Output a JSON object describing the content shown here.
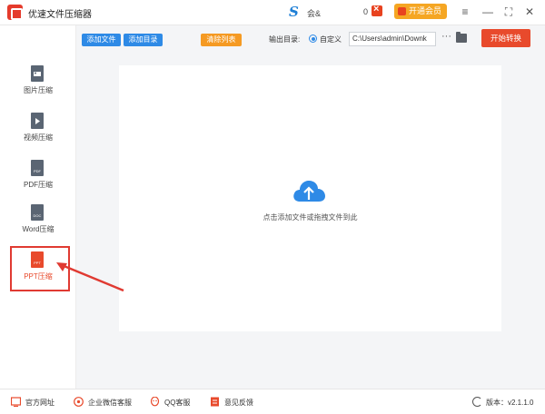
{
  "window": {
    "title": "优速文件压缩器",
    "user_name": "会&",
    "coin_count": "0",
    "vip_label": "开通会员",
    "controls": [
      "≡",
      "—",
      "⛶",
      "✕"
    ]
  },
  "toolbar": {
    "add_file": "添加文件",
    "add_dir": "添加目录",
    "clear_list": "清除列表",
    "output_label": "输出目录:",
    "radio_label": "自定义",
    "output_path": "C:\\Users\\admin\\Downk",
    "more": "···",
    "start": "开始转换"
  },
  "sidebar": {
    "items": [
      {
        "label": "图片压缩",
        "icon": "image-file-icon",
        "glyph": ""
      },
      {
        "label": "视频压缩",
        "icon": "video-file-icon",
        "glyph": ""
      },
      {
        "label": "PDF压缩",
        "icon": "pdf-file-icon",
        "glyph": "PDF"
      },
      {
        "label": "Word压缩",
        "icon": "doc-file-icon",
        "glyph": "DOC"
      },
      {
        "label": "PPT压缩",
        "icon": "ppt-file-icon",
        "glyph": "PPT",
        "active": true
      }
    ]
  },
  "main": {
    "drop_hint": "点击添加文件或拖拽文件到此"
  },
  "footer": {
    "links": [
      "官方网址",
      "企业微信客服",
      "QQ客服",
      "意见反馈"
    ],
    "version": "版本：v2.1.1.0"
  },
  "colors": {
    "accent_blue": "#2e8ae6",
    "accent_orange": "#f59a23",
    "accent_red": "#e84a2c",
    "highlight_red": "#e03a32"
  }
}
